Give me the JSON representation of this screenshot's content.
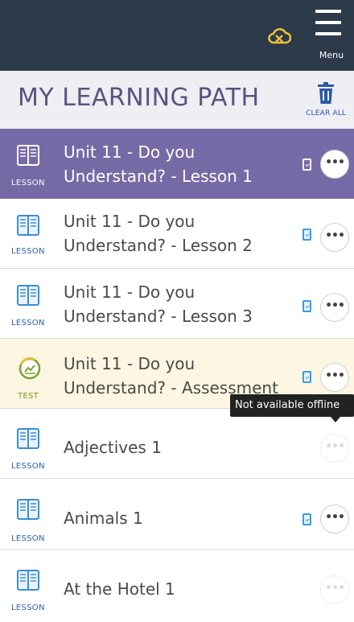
{
  "header": {
    "menu_label": "Menu",
    "cloud_icon": "offline-cloud-icon",
    "accent": "#e9c03a",
    "background": "#2c3a4a"
  },
  "path": {
    "title": "MY LEARNING PATH",
    "clear_label": "CLEAR ALL"
  },
  "items": [
    {
      "type": "LESSON",
      "title_line1": "Unit 11 - Do you",
      "title_line2": "Understand? - Lesson 1",
      "state": "active"
    },
    {
      "type": "LESSON",
      "title_line1": "Unit 11 - Do you",
      "title_line2": "Understand? - Lesson 2",
      "state": "normal"
    },
    {
      "type": "LESSON",
      "title_line1": "Unit 11 - Do you",
      "title_line2": "Understand? - Lesson 3",
      "state": "normal"
    },
    {
      "type": "TEST",
      "title_line1": "Unit 11 - Do you",
      "title_line2": "Understand? - Assessment",
      "state": "test"
    },
    {
      "type": "LESSON",
      "title": "Adjectives 1",
      "state": "unavailable"
    },
    {
      "type": "LESSON",
      "title": "Animals 1",
      "state": "normal"
    },
    {
      "type": "LESSON",
      "title": "At the Hotel 1",
      "state": "unavailable"
    }
  ],
  "tooltip": {
    "text": "Not available offline"
  },
  "more_glyph": "•••"
}
